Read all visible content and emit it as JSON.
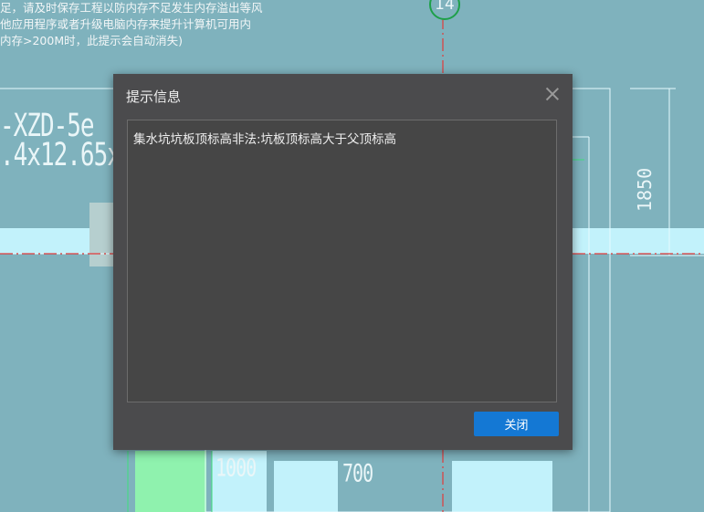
{
  "background": {
    "warning_lines": [
      "足，请及时保存工程以防内存不足发生内存溢出等风",
      "他应用程序或者升级电脑内存来提升计算机可用内",
      "内存>200M时，此提示会自动消失)"
    ],
    "grid_label": "14",
    "label_top": "-XZD-5e",
    "label_bottom": ".4x12.65x1",
    "dim_vertical": "1850",
    "dim_1000": "1000",
    "dim_700": "700"
  },
  "dialog": {
    "title": "提示信息",
    "message": "集水坑坑板顶标高非法:坑板顶标高大于父顶标高",
    "close_button_label": "关闭"
  },
  "colors": {
    "cad_background": "#7fb2bd",
    "dialog_background": "#4b4b4d",
    "primary_button": "#1478d4"
  }
}
